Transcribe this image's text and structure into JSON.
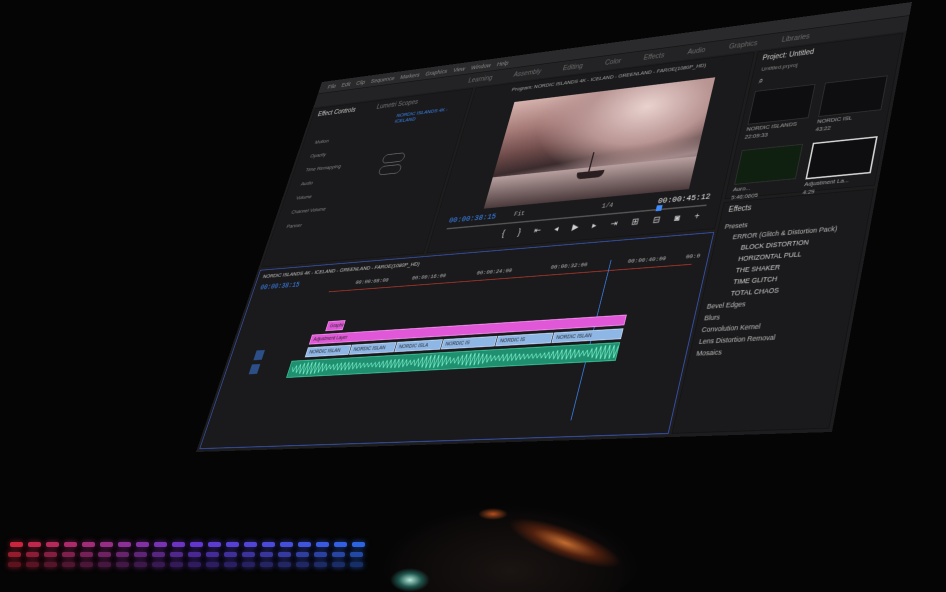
{
  "menu": [
    "File",
    "Edit",
    "Clip",
    "Sequence",
    "Markers",
    "Graphics",
    "View",
    "Window",
    "Help"
  ],
  "workspaces": [
    "Learning",
    "Assembly",
    "Editing",
    "Color",
    "Effects",
    "Audio",
    "Graphics",
    "Libraries"
  ],
  "program": {
    "title": "Program: NORDIC ISLANDS 4K - ICELAND - GREENLAND - FAROE(1080P_HD)",
    "current_tc": "00:00:38:15",
    "duration_tc": "00:00:45:12",
    "zoom": "Fit",
    "resolution": "1/4"
  },
  "source": {
    "tabs": [
      "Effect Controls",
      "Lumetri Scopes"
    ],
    "clip_ref": "NORDIC ISLANDS 4K - ICELAND",
    "rows": [
      "Motion",
      "Opacity",
      "Time Remapping",
      "Audio",
      "Volume",
      "Channel Volume",
      "Panner"
    ]
  },
  "project": {
    "title": "Project: Untitled",
    "file": "Untitled.prproj",
    "items": [
      {
        "name": "NORDIC ISLANDS",
        "meta": "22:09:33"
      },
      {
        "name": "NORDIC ISL",
        "meta": "43:22"
      },
      {
        "name": "Auro...",
        "meta": "5:46:0605"
      },
      {
        "name": "Adjustment La...",
        "meta": "4:29"
      }
    ]
  },
  "effects": {
    "title": "Effects",
    "tree": [
      {
        "level": 1,
        "label": "Presets"
      },
      {
        "level": 2,
        "label": "ERROR (Glitch & Distortion Pack)"
      },
      {
        "level": 3,
        "label": "BLOCK DISTORTION"
      },
      {
        "level": 3,
        "label": "HORIZONTAL PULL"
      },
      {
        "level": 3,
        "label": "THE SHAKER"
      },
      {
        "level": 3,
        "label": "TIME GLITCH"
      },
      {
        "level": 3,
        "label": "TOTAL CHAOS"
      },
      {
        "level": 1,
        "label": "Bevel Edges"
      },
      {
        "level": 1,
        "label": "Blurs"
      },
      {
        "level": 1,
        "label": "Convolution Kernel"
      },
      {
        "level": 1,
        "label": "Lens Distortion Removal"
      },
      {
        "level": 1,
        "label": "Mosaics"
      }
    ]
  },
  "timeline": {
    "title": "NORDIC ISLANDS 4K - ICELAND - GREENLAND - FAROE(1080P_HD)",
    "current_tc": "00:00:38:15",
    "ticks": [
      "00:00:08:00",
      "00:00:16:00",
      "00:00:24:00",
      "00:00:32:00",
      "00:00:40:00",
      "00:0"
    ],
    "title_clip": "Graphic",
    "adjustment_clip": "Adjustment Layer",
    "video_clips": [
      "NORDIC ISLAN",
      "NORDIC ISLAN",
      "NORDIC ISLA",
      "NORDIC IS",
      "NORDIC IS",
      "NORDIC ISLAN"
    ]
  },
  "colors": {
    "accent": "#3d8bff",
    "pink_clip": "#e058d8",
    "video_clip": "#8fb7e6",
    "audio_clip": "#1f8f6f"
  }
}
